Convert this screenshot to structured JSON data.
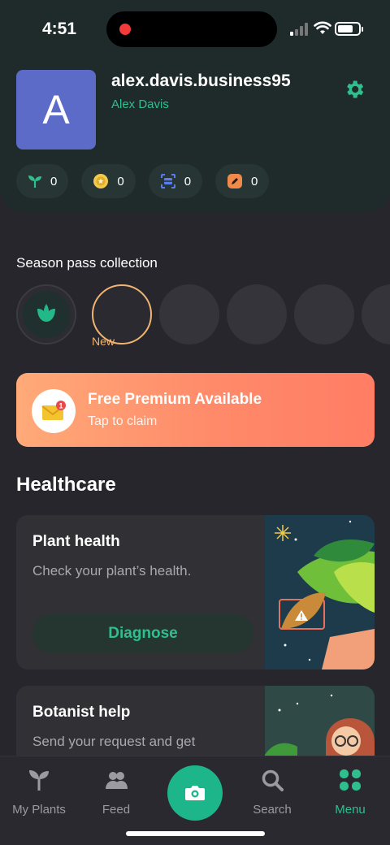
{
  "status": {
    "time": "4:51"
  },
  "profile": {
    "avatar_letter": "A",
    "username": "alex.davis.business95",
    "display_name": "Alex Davis"
  },
  "stats": [
    {
      "icon": "sprout-icon",
      "value": "0",
      "color": "#2fbf8e"
    },
    {
      "icon": "coin-icon",
      "value": "0",
      "color": "#f2c94c"
    },
    {
      "icon": "scan-icon",
      "value": "0",
      "color": "#5b7cf0"
    },
    {
      "icon": "pencil-badge-icon",
      "value": "0",
      "color": "#f08a4b"
    }
  ],
  "season_pass": {
    "title": "Season pass collection",
    "new_label": "New"
  },
  "promo": {
    "title": "Free Premium Available",
    "subtitle": "Tap to claim",
    "notification_count": "1"
  },
  "healthcare": {
    "title": "Healthcare",
    "cards": [
      {
        "title": "Plant health",
        "subtitle": "Check your plant’s health.",
        "button": "Diagnose"
      },
      {
        "title": "Botanist help",
        "subtitle": "Send your request and get"
      }
    ]
  },
  "nav": {
    "items": [
      {
        "label": "My Plants",
        "icon": "plant-icon"
      },
      {
        "label": "Feed",
        "icon": "people-icon"
      },
      {
        "label": "Search",
        "icon": "search-icon"
      },
      {
        "label": "Menu",
        "icon": "grid-icon",
        "active": true
      }
    ]
  },
  "colors": {
    "accent": "#2fbf8e",
    "promo_start": "#ffaa78",
    "promo_end": "#ff7d64"
  }
}
